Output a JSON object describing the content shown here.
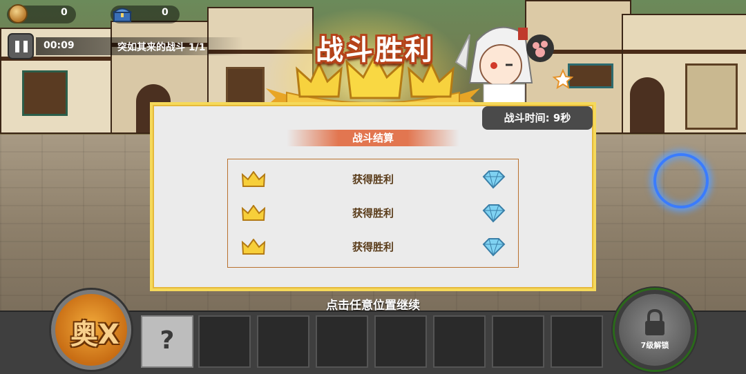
{
  "hud": {
    "coins": "0",
    "chests": "0",
    "timer": "00:09",
    "stage": "突如其来的战斗  1/1"
  },
  "victory": {
    "title": "战斗胜利",
    "stars_earned": 3,
    "stars_total": 3
  },
  "panel": {
    "battle_time": "战斗时间: 9秒",
    "summary_title": "战斗结算",
    "tasks": [
      {
        "label": "获得胜利",
        "crown": "crown-icon",
        "reward": "diamond-icon"
      },
      {
        "label": "获得胜利",
        "crown": "crown-icon",
        "reward": "diamond-icon"
      },
      {
        "label": "获得胜利",
        "crown": "crown-icon",
        "reward": "diamond-icon"
      }
    ]
  },
  "continue_hint": "点击任意位置继续",
  "skills": {
    "ultimate_text": "奥X",
    "unknown_slot": "?",
    "lock_label": "7级解锁",
    "empty_slots": 7
  },
  "colors": {
    "title_outline": "#b5431a",
    "panel_border": "#f5d95a",
    "summary_band": "#e27650",
    "task_text": "#5a3c1a",
    "ring": "#3a7cff"
  }
}
